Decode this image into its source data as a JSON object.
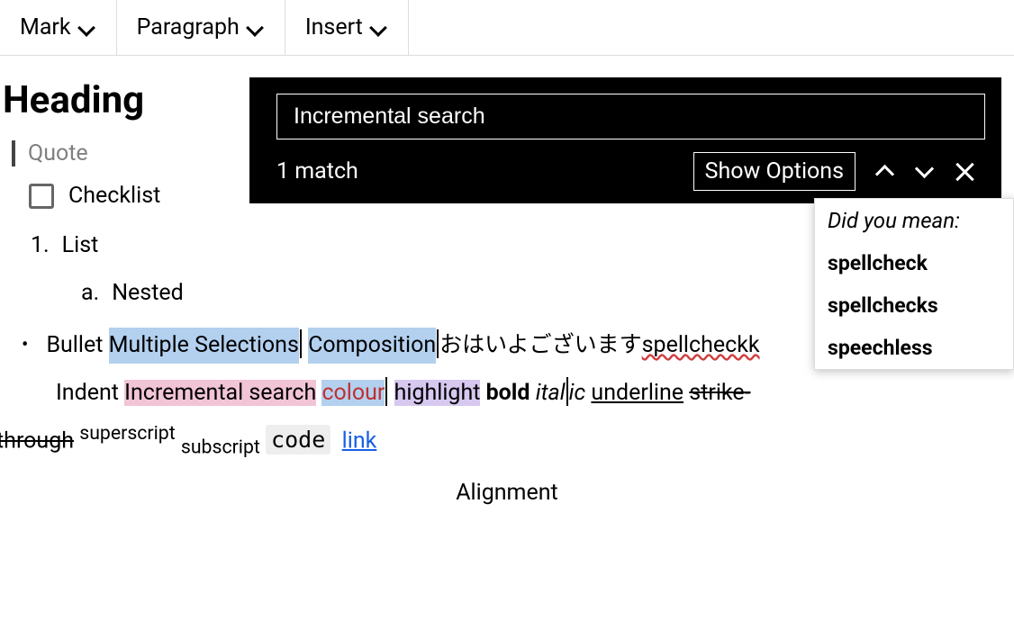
{
  "toolbar": {
    "mark": "Mark",
    "paragraph": "Paragraph",
    "insert": "Insert"
  },
  "doc": {
    "heading": "Heading",
    "quote": "Quote",
    "checklist": "Checklist",
    "list_number": "1.",
    "list_text": "List",
    "nested_letter": "a.",
    "nested_text": "Nested",
    "bullet_text": "Bullet",
    "sel_multiple": "Multiple Selections",
    "sel_composition": "Composition",
    "japanese": "おはいよございます",
    "spell_error": "spellcheckk",
    "indent_text": "Indent",
    "incremental_search": "Incremental search",
    "colour": "colour",
    "highlight": "highlight",
    "bold": "bold",
    "italic_pre": "ital",
    "italic_post": "ic",
    "underline": "underline",
    "strike_pre": "strike-",
    "strike_post": "through",
    "superscript": "superscript",
    "subscript": "subscript",
    "code": "code",
    "link": "link",
    "alignment": "Alignment"
  },
  "search": {
    "query": "Incremental search",
    "match_count": "1 match",
    "show_options": "Show Options"
  },
  "suggestions": {
    "header": "Did you mean:",
    "items": [
      "spellcheck",
      "spellchecks",
      "speechless"
    ]
  }
}
